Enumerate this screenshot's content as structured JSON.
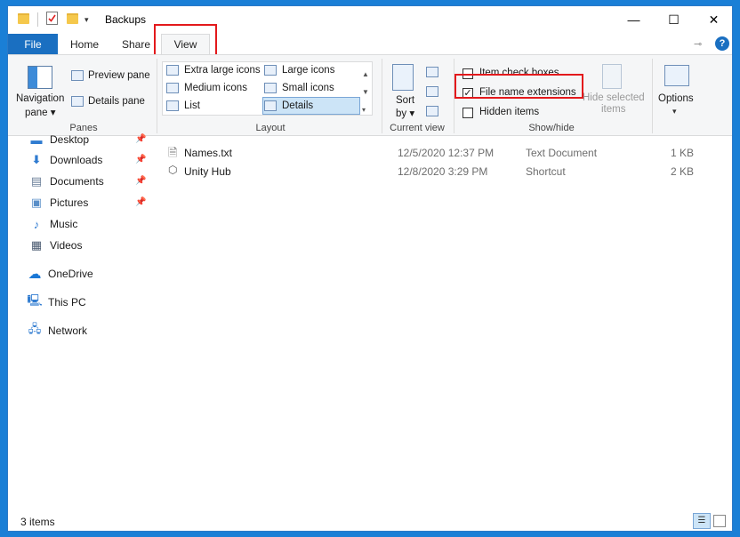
{
  "window": {
    "title": "Backups",
    "controls": {
      "minimize": "—",
      "maximize": "☐",
      "close": "✕"
    }
  },
  "tabs": {
    "file": "File",
    "home": "Home",
    "share": "Share",
    "view": "View"
  },
  "ribbon": {
    "panes": {
      "label": "Panes",
      "navigation_pane": "Navigation",
      "navigation_pane_2": "pane",
      "preview_pane": "Preview pane",
      "details_pane": "Details pane"
    },
    "layout": {
      "label": "Layout",
      "extra_large_icons": "Extra large icons",
      "large_icons": "Large icons",
      "medium_icons": "Medium icons",
      "small_icons": "Small icons",
      "list": "List",
      "details": "Details"
    },
    "current_view": {
      "label": "Current view",
      "sort": "Sort",
      "sort_by": "by"
    },
    "show_hide": {
      "label": "Show/hide",
      "item_check_boxes": "Item check boxes",
      "file_name_extensions": "File name extensions",
      "hidden_items": "Hidden items",
      "hide_selected": "Hide selected",
      "hide_selected_2": "items"
    },
    "options": {
      "label": "Options"
    }
  },
  "nav": {
    "quick_access": [
      {
        "label": "Desktop"
      },
      {
        "label": "Downloads"
      },
      {
        "label": "Documents"
      },
      {
        "label": "Pictures"
      },
      {
        "label": "Music"
      },
      {
        "label": "Videos"
      }
    ],
    "onedrive": "OneDrive",
    "this_pc": "This PC",
    "network": "Network"
  },
  "files": [
    {
      "name": "Names.txt",
      "date": "12/5/2020 12:37 PM",
      "type": "Text Document",
      "size": "1 KB"
    },
    {
      "name": "Unity Hub",
      "date": "12/8/2020 3:29 PM",
      "type": "Shortcut",
      "size": "2 KB"
    }
  ],
  "status": {
    "count": "3 items"
  },
  "accent_color": "#1a6fc1",
  "highlight_color": "#e3191c"
}
